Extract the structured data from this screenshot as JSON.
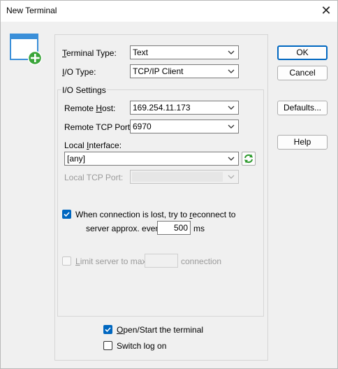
{
  "window": {
    "title": "New Terminal",
    "close_glyph": "✕"
  },
  "form": {
    "terminal_type": {
      "label_pre": "",
      "label_ul": "T",
      "label_post": "erminal Type:",
      "value": "Text"
    },
    "io_type": {
      "label_pre": "",
      "label_ul": "I",
      "label_post": "/O Type:",
      "value": "TCP/IP Client"
    },
    "io_settings_caption": "I/O Settings",
    "remote_host": {
      "label_pre": "Remote ",
      "label_ul": "H",
      "label_post": "ost:",
      "value": "169.254.11.173"
    },
    "remote_port": {
      "label": "Remote TCP Port:",
      "value": "6970"
    },
    "local_interface": {
      "label_pre": "Local ",
      "label_ul": "I",
      "label_post": "nterface:",
      "value": "[any]"
    },
    "local_port": {
      "label": "Local TCP Port:",
      "value": ""
    },
    "reconnect": {
      "line1_pre": "When connection is lost, try to ",
      "line1_ul": "r",
      "line1_post": "econnect to",
      "line2": "server approx. every",
      "value": "500",
      "unit": "ms",
      "checked": true
    },
    "limit": {
      "label_pre": "",
      "label_ul": "L",
      "label_post": "imit server to max.",
      "value": "",
      "unit": "connection",
      "checked": false
    },
    "open_start": {
      "label_pre": "",
      "label_ul": "O",
      "label_post": "pen/Start the terminal",
      "checked": true
    },
    "switch_log": {
      "label": "Switch log on",
      "checked": false
    }
  },
  "buttons": {
    "ok": "OK",
    "cancel": "Cancel",
    "defaults": "Defaults...",
    "help": "Help"
  },
  "icons": {
    "terminal": "new-terminal-icon",
    "refresh": "refresh-icon",
    "dropdown": "chevron-down-icon",
    "check": "checkmark-icon",
    "close": "close-icon"
  },
  "colors": {
    "accent": "#0067c0",
    "icon_green": "#3aa53a"
  }
}
